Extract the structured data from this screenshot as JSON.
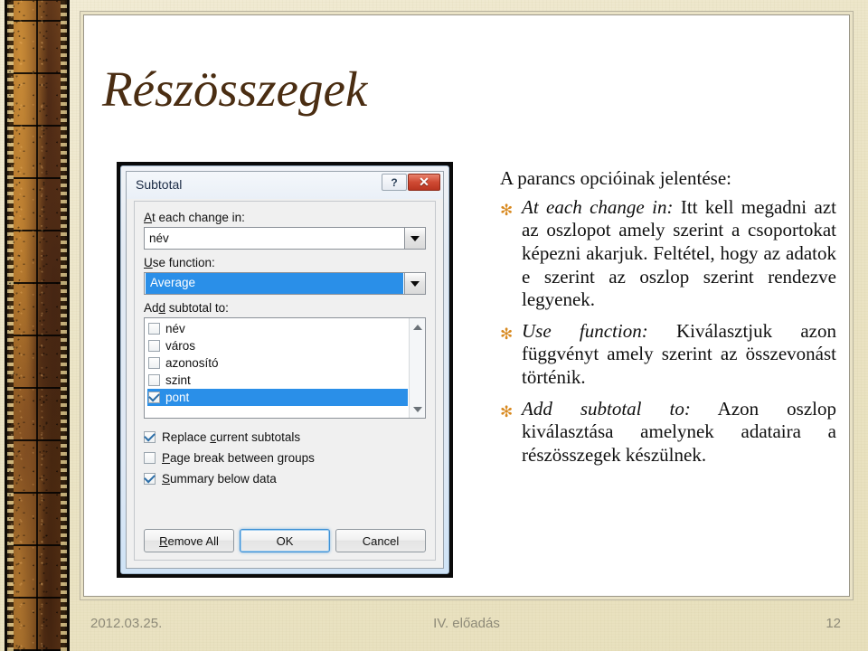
{
  "slide": {
    "title": "Részösszegek"
  },
  "dialog": {
    "title": "Subtotal",
    "help_button": "?",
    "close_button": "✕",
    "at_each_change": {
      "label_prefix": "",
      "label_accel": "A",
      "label_rest": "t each change in:",
      "label_full": "At each change in:",
      "value": "név"
    },
    "use_function": {
      "label_accel": "U",
      "label_rest": "se function:",
      "label_full": "Use function:",
      "value": "Average",
      "selected": true
    },
    "add_subtotal_to": {
      "label_pre": "Ad",
      "label_accel": "d",
      "label_rest": " subtotal to:",
      "label_full": "Add subtotal to:",
      "items": [
        {
          "label": "név",
          "checked": false,
          "selected": false
        },
        {
          "label": "város",
          "checked": false,
          "selected": false
        },
        {
          "label": "azonosító",
          "checked": false,
          "selected": false
        },
        {
          "label": "szint",
          "checked": false,
          "selected": false
        },
        {
          "label": "pont",
          "checked": true,
          "selected": true
        }
      ]
    },
    "options": [
      {
        "pre": "Replace ",
        "accel": "c",
        "rest": "urrent subtotals",
        "full": "Replace current subtotals",
        "checked": true
      },
      {
        "pre": "",
        "accel": "P",
        "rest": "age break between groups",
        "full": "Page break between groups",
        "checked": false
      },
      {
        "pre": "",
        "accel": "S",
        "rest": "ummary below data",
        "full": "Summary below data",
        "checked": true
      }
    ],
    "buttons": [
      {
        "pre": "",
        "accel": "R",
        "rest": "emove All",
        "full": "Remove All",
        "default": false
      },
      {
        "pre": "",
        "accel": "",
        "rest": "OK",
        "full": "OK",
        "default": true
      },
      {
        "pre": "",
        "accel": "",
        "rest": "Cancel",
        "full": "Cancel",
        "default": false
      }
    ]
  },
  "explanation": {
    "intro": "A parancs opcióinak jelentése:",
    "bullet_marker": "✻",
    "bullets": [
      {
        "lead": "At each change in:",
        "body": " Itt kell megadni azt az oszlopot amely szerint a csoportokat képezni akarjuk. Feltétel, hogy az adatok e szerint az oszlop szerint rendezve legyenek."
      },
      {
        "lead": "Use function:",
        "body": " Kiválasztjuk azon függvényt amely szerint az összevonást történik."
      },
      {
        "lead": "Add subtotal to:",
        "body": " Azon oszlop kiválasztása amelynek adataira a részösszegek készülnek."
      }
    ]
  },
  "footer": {
    "date": "2012.03.25.",
    "center": "IV. előadás",
    "page": "12"
  },
  "colors": {
    "title": "#4a2d12",
    "bullet": "#d8891f",
    "selection": "#2a8fe8",
    "footer_text": "#8e8a78",
    "background": "#ebe4c6"
  }
}
